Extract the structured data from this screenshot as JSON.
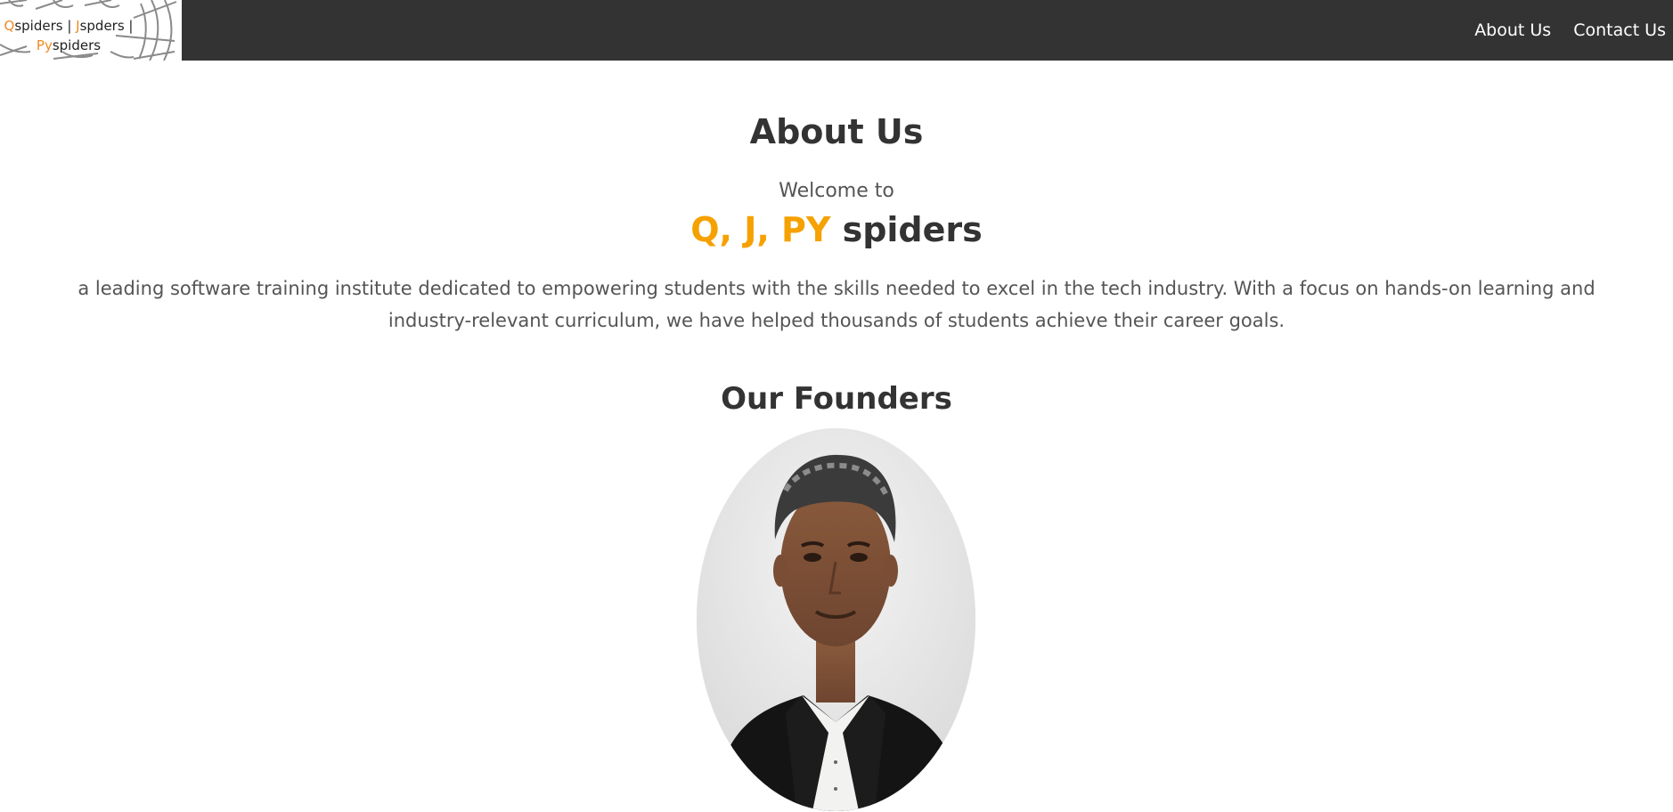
{
  "header": {
    "logo": {
      "line1_q": "Q",
      "line1_rest1": "spiders | ",
      "line1_j": "J",
      "line1_rest2": "spders |",
      "line2_py": "Py",
      "line2_rest": "spiders"
    },
    "nav": [
      {
        "label": "About Us"
      },
      {
        "label": "Contact Us"
      }
    ]
  },
  "main": {
    "title": "About Us",
    "welcome": "Welcome to",
    "brand_highlight": "Q, J, PY",
    "brand_rest": " spiders",
    "description": "a leading software training institute dedicated to empowering students with the skills needed to excel in the tech industry. With a focus on hands-on learning and industry-relevant curriculum, we have helped thousands of students achieve their career goals.",
    "founders_title": "Our Founders"
  },
  "colors": {
    "navbar_bg": "#333333",
    "brand_accent": "#f5a100",
    "logo_accent": "#f08a24"
  }
}
